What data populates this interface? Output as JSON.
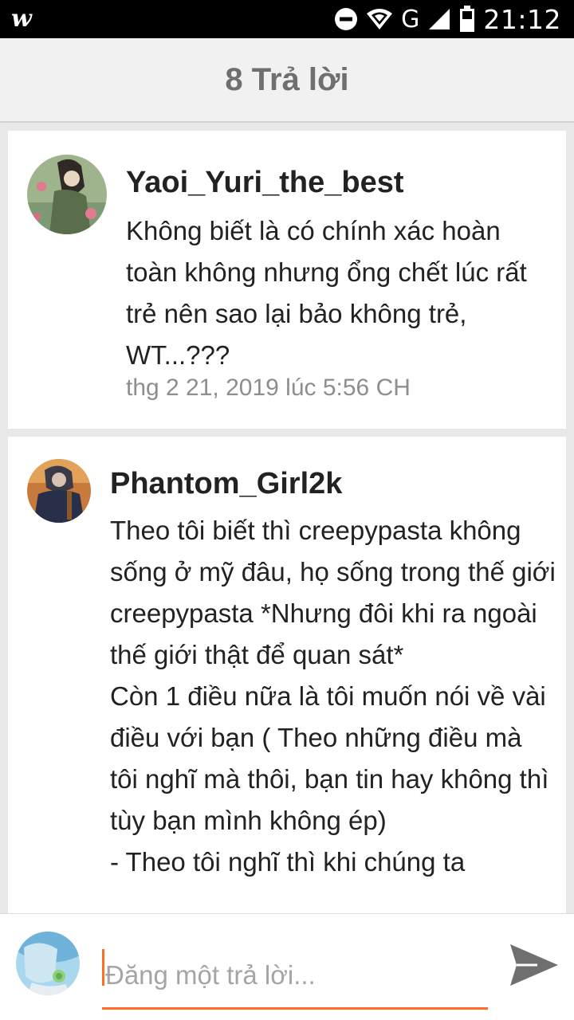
{
  "status_bar": {
    "app_logo": "w",
    "network": "G",
    "time": "21:12",
    "icons": [
      "wattpad-logo-icon",
      "do-not-disturb-icon",
      "wifi-icon",
      "cellular-signal-icon",
      "battery-icon"
    ]
  },
  "header": {
    "title": "8 Trả lời"
  },
  "comments": [
    {
      "username": "Yaoi_Yuri_the_best",
      "text": "Không biết là có chính xác hoàn toàn không nhưng ổng chết lúc rất trẻ nên sao lại bảo không trẻ, WT...???",
      "timestamp": "thg 2 21, 2019 lúc 5:56 CH"
    },
    {
      "username": "Phantom_Girl2k",
      "text": "Theo tôi biết thì creepypasta không sống ở mỹ đâu, họ sống trong thế giới creepypasta *Nhưng đôi khi ra ngoài thế giới thật để quan sát*\nCòn 1 điều nữa là tôi muốn nói về vài điều với bạn ( Theo những điều mà tôi nghĩ mà thôi, bạn tin hay không thì tùy bạn mình không ép)\n- Theo tôi nghĩ thì khi chúng ta"
    }
  ],
  "composer": {
    "placeholder": "Đăng một trả lời..."
  },
  "colors": {
    "accent": "#ff6d29",
    "header_bg": "#f1f1f1",
    "page_bg": "#e8e8e8"
  }
}
